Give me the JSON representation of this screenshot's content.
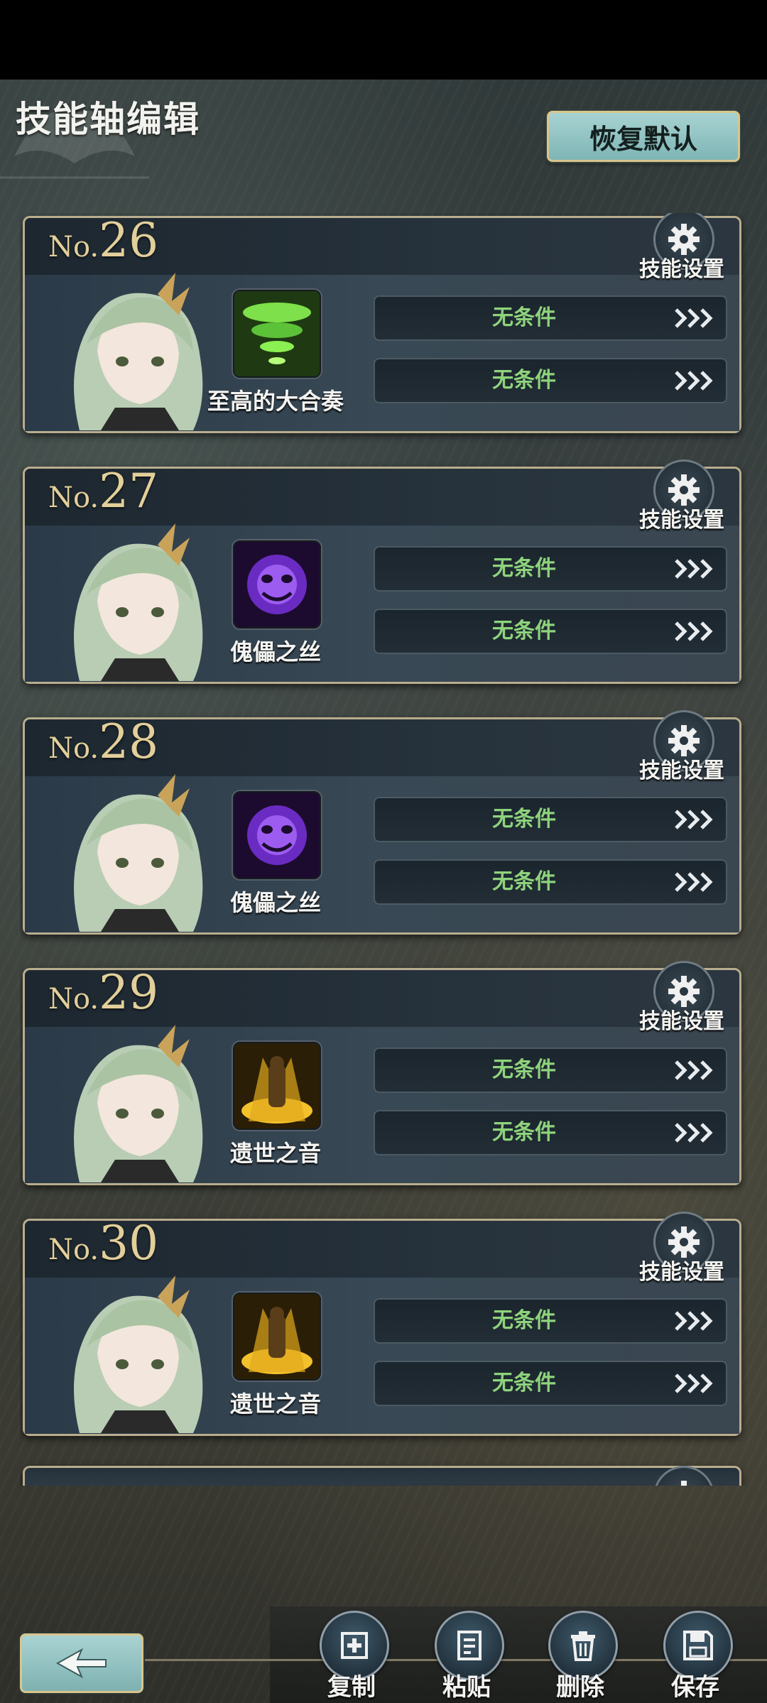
{
  "header": {
    "title": "技能轴编辑",
    "reset_label": "恢复默认"
  },
  "cards": [
    {
      "no_prefix": "No.",
      "number": "26",
      "settings_label": "技能设置",
      "skill_name": "至高的大合奏",
      "skill_icon": "green-tornado-icon",
      "conditions": [
        "无条件",
        "无条件"
      ]
    },
    {
      "no_prefix": "No.",
      "number": "27",
      "settings_label": "技能设置",
      "skill_name": "傀儡之丝",
      "skill_icon": "purple-ghost-icon",
      "conditions": [
        "无条件",
        "无条件"
      ]
    },
    {
      "no_prefix": "No.",
      "number": "28",
      "settings_label": "技能设置",
      "skill_name": "傀儡之丝",
      "skill_icon": "purple-ghost-icon",
      "conditions": [
        "无条件",
        "无条件"
      ]
    },
    {
      "no_prefix": "No.",
      "number": "29",
      "settings_label": "技能设置",
      "skill_name": "遗世之音",
      "skill_icon": "golden-figure-icon",
      "conditions": [
        "无条件",
        "无条件"
      ]
    },
    {
      "no_prefix": "No.",
      "number": "30",
      "settings_label": "技能设置",
      "skill_name": "遗世之音",
      "skill_icon": "golden-figure-icon",
      "conditions": [
        "无条件",
        "无条件"
      ]
    }
  ],
  "actions": {
    "copy": "复制",
    "paste": "粘贴",
    "delete": "删除",
    "save": "保存"
  },
  "colors": {
    "condition_text": "#8ed37c",
    "number_gold": "#e3cf9a",
    "accent_teal": "#8fc3c2"
  }
}
